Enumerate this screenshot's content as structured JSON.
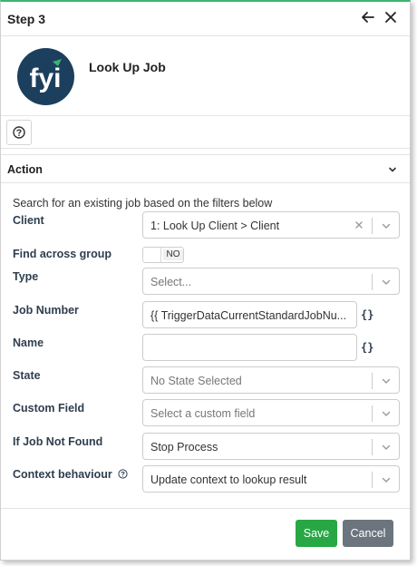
{
  "header": {
    "title": "Step 3",
    "back_icon": "arrow-left-icon",
    "close_icon": "close-icon"
  },
  "step": {
    "name": "Look Up Job",
    "logo_text": "fyi",
    "logo_color": "#1d3f5e",
    "logo_accent": "#3cb371"
  },
  "help": {
    "icon": "question-circle-icon"
  },
  "action": {
    "title": "Action",
    "description": "Search for an existing job based on the filters below",
    "fields": {
      "client": {
        "label": "Client",
        "value": "1: Look Up Client > Client"
      },
      "find_across_group": {
        "label": "Find across group",
        "toggle_text": "NO"
      },
      "type": {
        "label": "Type",
        "placeholder": "Select..."
      },
      "job_number": {
        "label": "Job Number",
        "value": "{{ TriggerDataCurrentStandardJobNu..."
      },
      "name": {
        "label": "Name",
        "value": ""
      },
      "state": {
        "label": "State",
        "placeholder": "No State Selected"
      },
      "custom_field": {
        "label": "Custom Field",
        "placeholder": "Select a custom field"
      },
      "if_job_not_found": {
        "label": "If Job Not Found",
        "value": "Stop Process"
      },
      "context_behaviour": {
        "label": "Context behaviour",
        "value": "Update context to lookup result"
      }
    },
    "variable_icon": "{}"
  },
  "footer": {
    "save_label": "Save",
    "cancel_label": "Cancel",
    "save_color": "#28a745",
    "cancel_color": "#6c757d"
  }
}
